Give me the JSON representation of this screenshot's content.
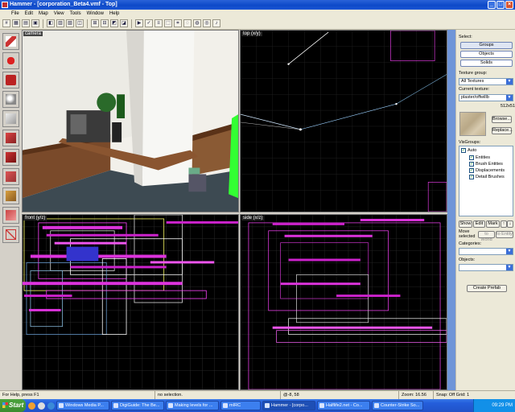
{
  "window": {
    "title": "Hammer - [corporation_Beta4.vmf - Top]"
  },
  "menu": [
    "File",
    "Edit",
    "Map",
    "View",
    "Tools",
    "Window",
    "Help"
  ],
  "viewports": {
    "camera": "camera",
    "top": "top (x/y)",
    "front": "front (y/z)",
    "side": "side (x/z)"
  },
  "panel": {
    "select_label": "Select:",
    "groups": "Groups",
    "objects": "Objects",
    "solids": "Solids",
    "texture_group_label": "Texture group:",
    "texture_group_value": "All Textures",
    "current_texture_label": "Current texture:",
    "current_texture_value": "plaster/offwillb",
    "texture_size": "512x512",
    "browse": "Browse...",
    "replace": "Replace...",
    "visgroups_label": "VisGroups:",
    "visgroups": [
      "Auto",
      "Entities",
      "Brush Entities",
      "Displacements",
      "Detail Brushes"
    ],
    "show": "Show",
    "edit": "Edit",
    "mark": "Mark",
    "move_selected": "Move selected",
    "categories_label": "Categories:",
    "objects_label": "Objects:",
    "create_prefab": "Create Prefab",
    "small_btns": [
      "to World",
      "to Entity"
    ]
  },
  "status": {
    "help": "For Help, press F1",
    "selection": "no selection.",
    "coords": "@-8, 58",
    "zoom": "Zoom: 16.56",
    "snap": "Snap: Off Grid: 1"
  },
  "taskbar": {
    "start": "Start",
    "tasks": [
      "Windows Media P...",
      "DigiGuide: The Be...",
      "Making levels for ...",
      "mIRC",
      "Hammer - [corpo...",
      "Halflife2.net - Co...",
      "Counter-Strike So..."
    ],
    "clock": "09:29 PM"
  },
  "colors": {
    "selection_pink": "#ff44ff",
    "grid": "#3a3a3a",
    "titlebar": "#0d49c8"
  }
}
